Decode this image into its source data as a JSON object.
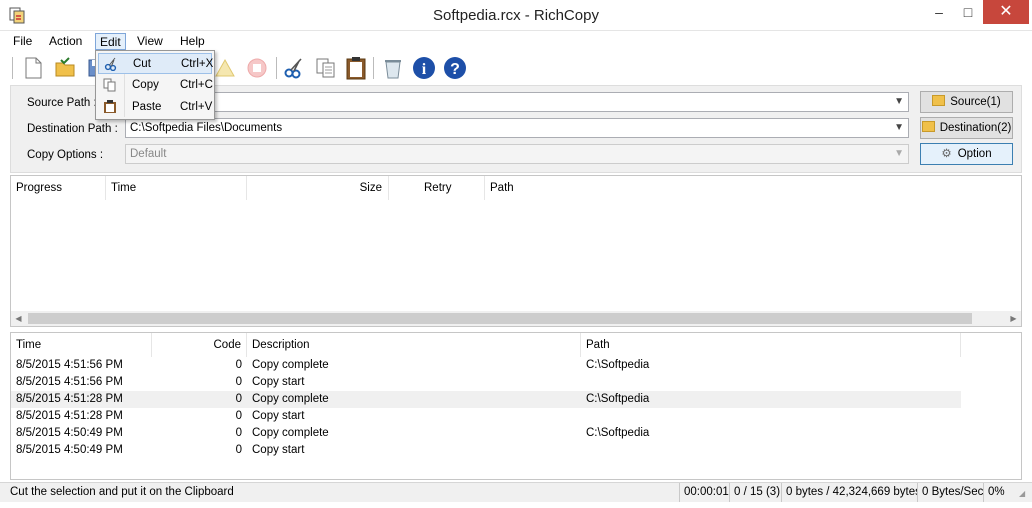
{
  "window": {
    "title": "Softpedia.rcx - RichCopy",
    "minimize": "–",
    "maximize": "□",
    "close": "✕"
  },
  "menu": [
    {
      "label": "File"
    },
    {
      "label": "Action"
    },
    {
      "label": "Edit"
    },
    {
      "label": "View"
    },
    {
      "label": "Help"
    }
  ],
  "toolbar": {
    "icons": [
      "new-file-icon",
      "open-icon",
      "save-icon",
      "start-icon",
      "pause-icon",
      "stop-icon",
      "cut-icon",
      "copy-icon",
      "paste-icon",
      "recycle-bin-icon",
      "info-icon",
      "help-icon"
    ]
  },
  "edit_menu": {
    "items": [
      {
        "label": "Cut",
        "shortcut": "Ctrl+X"
      },
      {
        "label": "Copy",
        "shortcut": "Ctrl+C"
      },
      {
        "label": "Paste",
        "shortcut": "Ctrl+V"
      }
    ]
  },
  "form": {
    "source_label": "Source Path :",
    "source_value": "",
    "destination_label": "Destination Path :",
    "destination_value": "C:\\Softpedia Files\\Documents",
    "options_label": "Copy Options :",
    "options_value": "Default",
    "source_button": "Source(1)",
    "destination_button": "Destination(2)",
    "option_button": "Option"
  },
  "progress_table": {
    "headers": [
      "Progress",
      "Time",
      "Size",
      "Retry",
      "Path"
    ]
  },
  "log_table": {
    "headers": [
      "Time",
      "Code",
      "Description",
      "Path"
    ],
    "rows": [
      {
        "time": "8/5/2015 4:51:56 PM",
        "code": "0",
        "description": "Copy complete",
        "path": "C:\\Softpedia"
      },
      {
        "time": "8/5/2015 4:51:56 PM",
        "code": "0",
        "description": "Copy start",
        "path": ""
      },
      {
        "time": "8/5/2015 4:51:28 PM",
        "code": "0",
        "description": "Copy complete",
        "path": "C:\\Softpedia"
      },
      {
        "time": "8/5/2015 4:51:28 PM",
        "code": "0",
        "description": "Copy start",
        "path": ""
      },
      {
        "time": "8/5/2015 4:50:49 PM",
        "code": "0",
        "description": "Copy complete",
        "path": "C:\\Softpedia"
      },
      {
        "time": "8/5/2015 4:50:49 PM",
        "code": "0",
        "description": "Copy start",
        "path": ""
      }
    ]
  },
  "status": {
    "message": "Cut the selection and put it on the Clipboard",
    "elapsed": "00:00:01",
    "files": "0 / 15 (3)",
    "bytes": "0 bytes / 42,324,669 bytes",
    "speed": "0 Bytes/Sec",
    "percent": "0%"
  },
  "colors": {
    "close_button": "#c7473c",
    "menu_highlight": "#e5f0fb",
    "selected_row": "#f0f0f0"
  }
}
